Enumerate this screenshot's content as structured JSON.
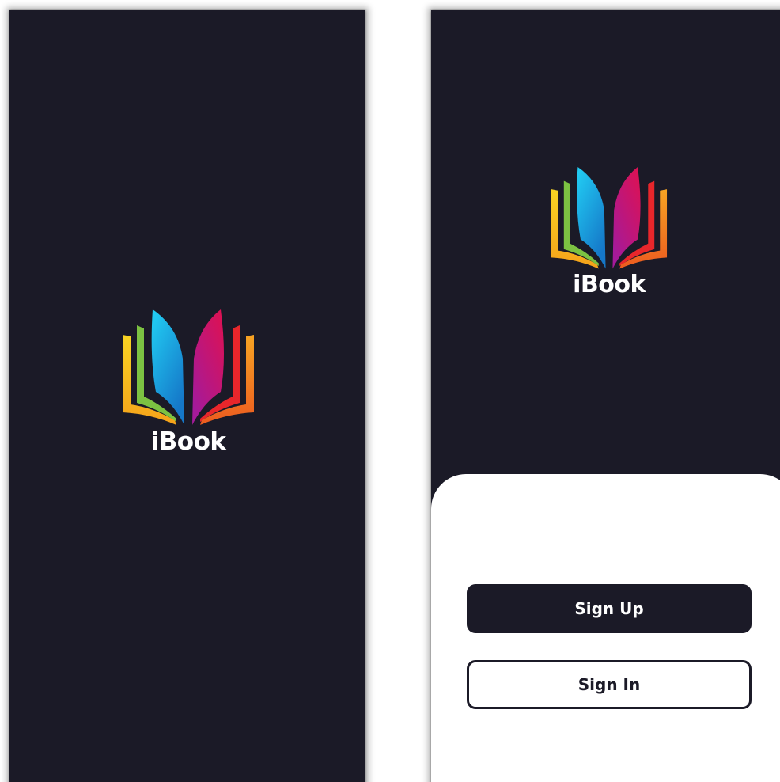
{
  "colors": {
    "background": "#1b1a27",
    "sheet": "#ffffff",
    "logo_text": "#ffffff",
    "book_blue": "#1fb5ea",
    "book_magenta": "#d3146f",
    "book_green": "#7cc242",
    "book_yellow": "#f7c21c",
    "book_red": "#e8262b",
    "book_orange": "#f58a1f"
  },
  "splash_screen": {
    "logo": {
      "icon": "open-book-logo-icon",
      "text": "iBook"
    }
  },
  "welcome_screen": {
    "logo": {
      "icon": "open-book-logo-icon",
      "text": "iBook"
    },
    "sign_up_label": "Sign Up",
    "sign_in_label": "Sign In"
  }
}
